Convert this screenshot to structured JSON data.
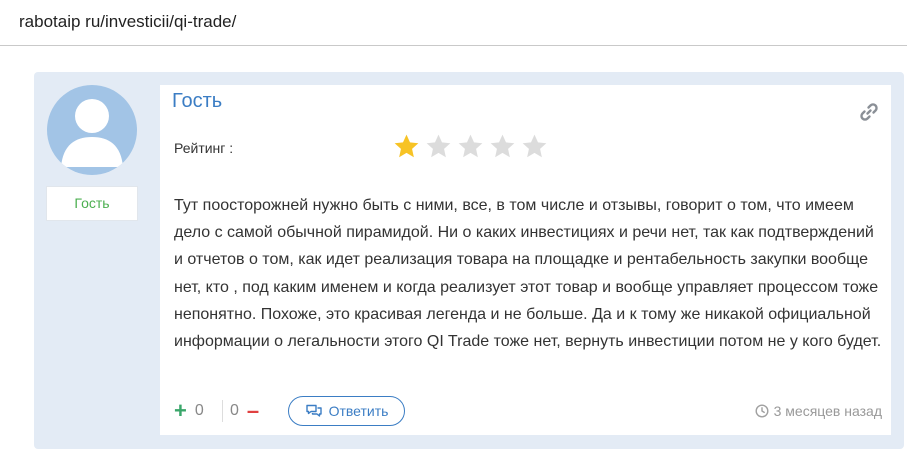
{
  "url_bar": {
    "text": "rabotaip ru/investicii/qi-trade/"
  },
  "comment": {
    "author": "Гость",
    "user_badge": "Гость",
    "rating_label": "Рейтинг :",
    "rating": {
      "value": 1,
      "max": 5,
      "filled_color": "#f7c325",
      "empty_color": "#dcdcdc"
    },
    "text": "Тут поосторожней нужно быть с ними, все, в том числе и отзывы, говорит о том, что имеем дело с самой обычной пирамидой. Ни о каких инвестициях и речи нет, так как подтверждений и отчетов о том, как идет реализация товара на площадке и рентабельность закупки вообще нет, кто , под каким именем и когда реализует этот товар и вообще управляет процессом тоже непонятно. Похоже, это красивая легенда и не больше. Да и к тому же никакой официальной информации о легальности этого QI Trade тоже нет, вернуть инвестиции потом не у кого будет.",
    "votes": {
      "up": "0",
      "down": "0"
    },
    "reply_label": "Ответить",
    "timestamp": "3 месяцев назад"
  },
  "icons": {
    "avatar": "default-user-avatar",
    "link": "link-icon",
    "vote_up": "plus-icon",
    "vote_down": "minus-icon",
    "reply": "speech-bubbles-icon",
    "time": "clock-icon"
  },
  "colors": {
    "card_bg": "#e3ebf5",
    "author": "#3b7dc4",
    "badge_text": "#4caf50",
    "vote_up": "#3aa66a",
    "vote_down": "#e04040"
  }
}
